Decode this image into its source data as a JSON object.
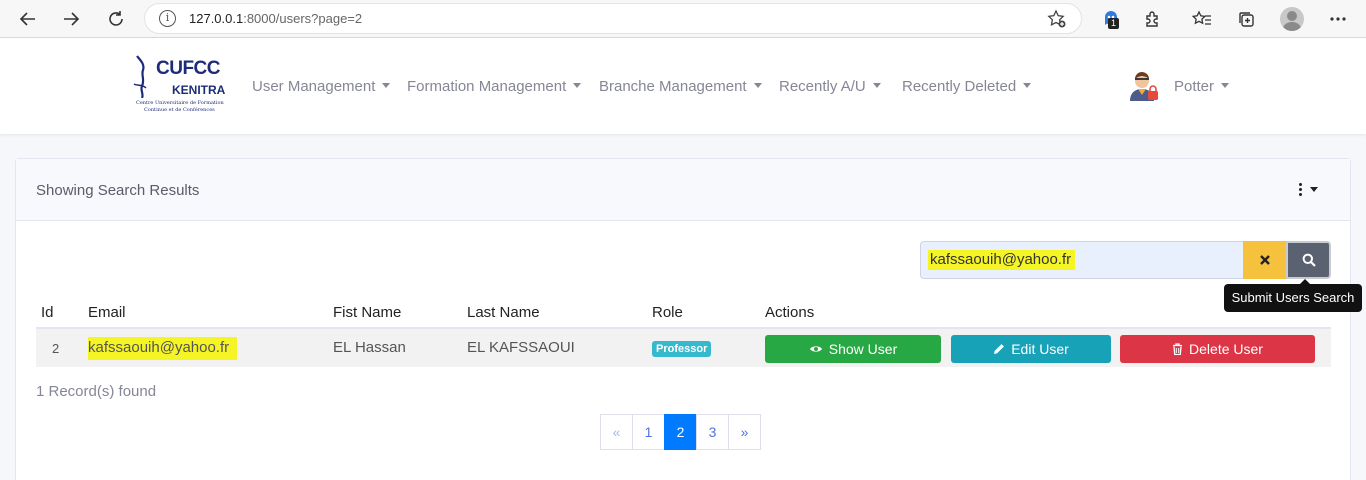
{
  "browser": {
    "url_host": "127.0.0.1",
    "url_rest": ":8000/users?page=2",
    "extension_badge": "1"
  },
  "navbar": {
    "logo": {
      "line1": "CUFCC",
      "line2": "KENITRA",
      "line3": "Centre Universitaire de Formation",
      "line4": "Continue et de Conférences"
    },
    "menu": [
      {
        "label": "User Management"
      },
      {
        "label": "Formation Management"
      },
      {
        "label": "Branche Management"
      },
      {
        "label": "Recently A/U"
      },
      {
        "label": "Recently Deleted"
      }
    ],
    "user": "Potter"
  },
  "card": {
    "title": "Showing Search Results",
    "search": {
      "value": "kafssaouih@yahoo.fr",
      "tooltip": "Submit Users Search"
    },
    "table": {
      "columns": [
        "Id",
        "Email",
        "Fist Name",
        "Last Name",
        "Role",
        "Actions"
      ],
      "rows": [
        {
          "id": "2",
          "email": "kafssaouih@yahoo.fr",
          "first_name": "EL Hassan",
          "last_name": "EL KAFSSAOUI",
          "role": "Professor",
          "actions": {
            "show": "Show User",
            "edit": "Edit User",
            "delete": "Delete User"
          }
        }
      ]
    },
    "records": "1 Record(s) found",
    "pagination": [
      "«",
      "1",
      "2",
      "3",
      "»"
    ]
  },
  "colors": {
    "show": "#28a745",
    "edit": "#17a2b8",
    "delete": "#dc3545",
    "clear": "#f6c23e",
    "search": "#5a6170",
    "highlight": "#f5f525"
  }
}
